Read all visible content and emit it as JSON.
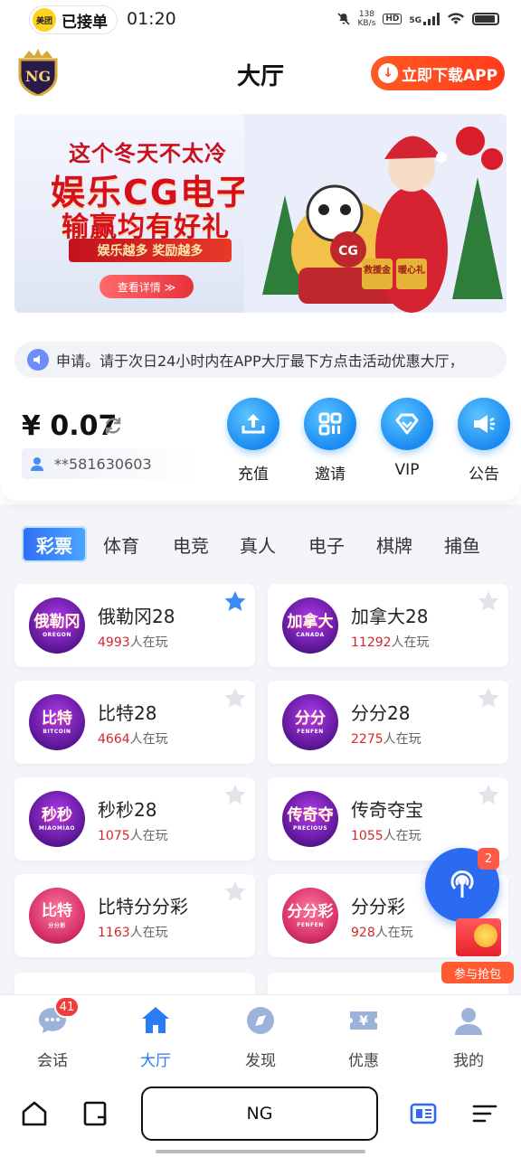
{
  "status_bar": {
    "app_pill_icon": "美团",
    "app_pill_label": "已接单",
    "time": "01:20",
    "net_speed_top": "138",
    "net_speed_bottom": "KB/s",
    "hd": "HD",
    "gen": "5G"
  },
  "header": {
    "logo": "NG",
    "title": "大厅",
    "download_label": "立即下载APP"
  },
  "banner": {
    "line1": "这个冬天不太冷",
    "line2": "娱乐CG电子",
    "line3": "输赢均有好礼",
    "sub": "娱乐越多 奖励越多",
    "button": "查看详情 ≫",
    "art_brand": "CG",
    "art_tag1": "救援金",
    "art_tag2": "暖心礼"
  },
  "notice": {
    "text": "申请。请于次日24小时内在APP大厅最下方点击活动优惠大厅，"
  },
  "account": {
    "balance": "¥ 0.07",
    "user_id": "**581630603",
    "actions": [
      {
        "label": "充值",
        "icon": "upload-icon"
      },
      {
        "label": "邀请",
        "icon": "qr-icon"
      },
      {
        "label": "VIP",
        "icon": "diamond-icon"
      },
      {
        "label": "公告",
        "icon": "megaphone-icon"
      }
    ]
  },
  "categories": [
    "彩票",
    "体育",
    "电竞",
    "真人",
    "电子",
    "棋牌",
    "捕鱼"
  ],
  "games": [
    {
      "name": "俄勒冈28",
      "players": "4993",
      "suffix": "人在玩",
      "icon_text": "俄勒冈",
      "icon_sub": "OREGON",
      "favorite": true
    },
    {
      "name": "加拿大28",
      "players": "11292",
      "suffix": "人在玩",
      "icon_text": "加拿大",
      "icon_sub": "CANADA",
      "favorite": false
    },
    {
      "name": "比特28",
      "players": "4664",
      "suffix": "人在玩",
      "icon_text": "比特",
      "icon_sub": "BITCOIN",
      "favorite": false
    },
    {
      "name": "分分28",
      "players": "2275",
      "suffix": "人在玩",
      "icon_text": "分分",
      "icon_sub": "FENFEN",
      "favorite": false
    },
    {
      "name": "秒秒28",
      "players": "1075",
      "suffix": "人在玩",
      "icon_text": "秒秒",
      "icon_sub": "MIAOMIAO",
      "favorite": false
    },
    {
      "name": "传奇夺宝",
      "players": "1055",
      "suffix": "人在玩",
      "icon_text": "传奇夺",
      "icon_sub": "PRECIOUS",
      "favorite": false
    },
    {
      "name": "比特分分彩",
      "players": "1163",
      "suffix": "人在玩",
      "icon_text": "比特",
      "icon_sub": "分分彩",
      "favorite": false
    },
    {
      "name": "分分彩",
      "players": "928",
      "suffix": "人在玩",
      "icon_text": "分分彩",
      "icon_sub": "FENFEN",
      "favorite": false
    }
  ],
  "floating": {
    "badge": "2",
    "red_packet_label": "参与抢包"
  },
  "bottom_nav": {
    "badge": "41",
    "items": [
      {
        "label": "会话",
        "icon": "chat-icon"
      },
      {
        "label": "大厅",
        "icon": "home-icon"
      },
      {
        "label": "发现",
        "icon": "compass-icon"
      },
      {
        "label": "优惠",
        "icon": "coupon-icon"
      },
      {
        "label": "我的",
        "icon": "user-icon"
      }
    ],
    "active": "大厅"
  },
  "browser_bar": {
    "url_text": "NG"
  },
  "colors": {
    "accent": "#2a7bf4",
    "download_button": "#ff4a1e",
    "player_count": "#d3272d",
    "favorite_star": "#3b8cf5"
  }
}
